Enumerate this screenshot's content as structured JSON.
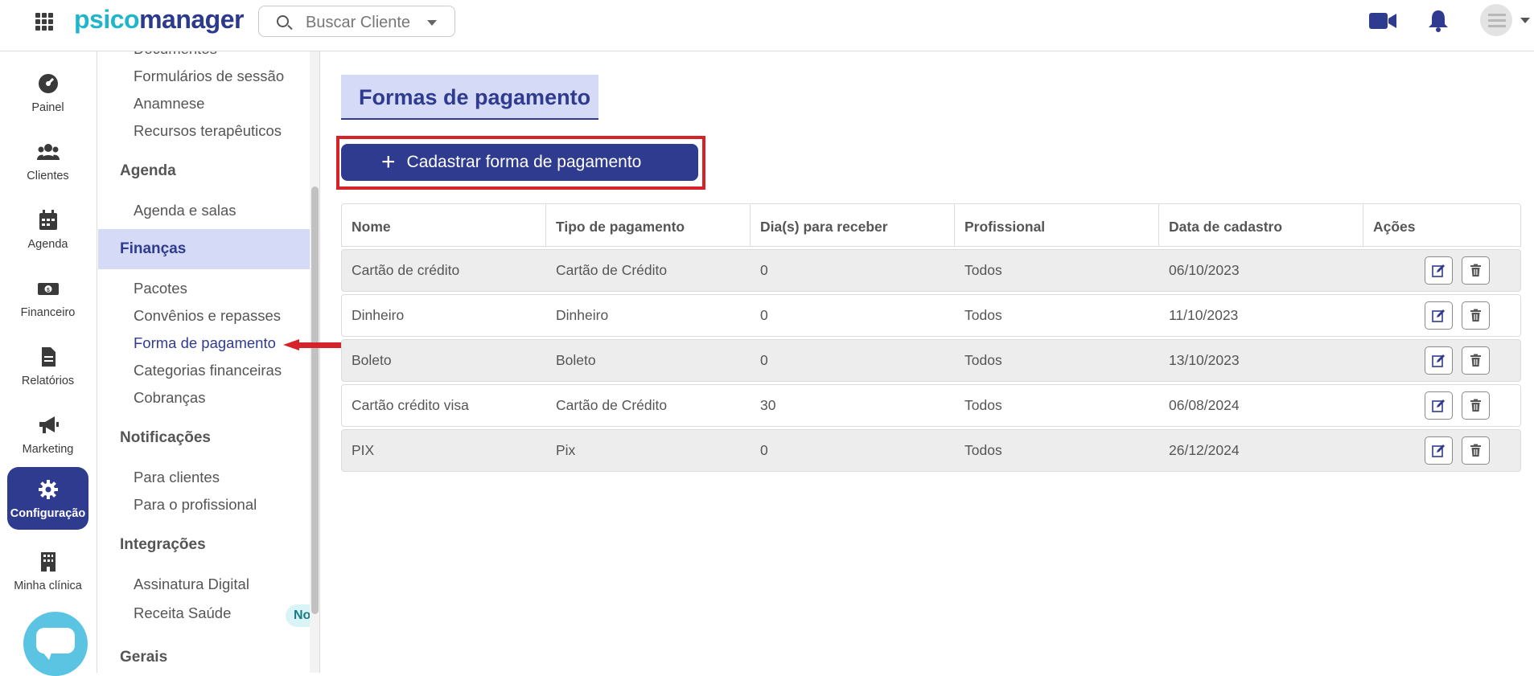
{
  "header": {
    "logo_part1": "psico",
    "logo_part2": "manager",
    "search_placeholder": "Buscar Cliente"
  },
  "rail": {
    "items": [
      {
        "label": "Painel",
        "icon": "dashboard-icon"
      },
      {
        "label": "Clientes",
        "icon": "users-icon"
      },
      {
        "label": "Agenda",
        "icon": "calendar-icon"
      },
      {
        "label": "Financeiro",
        "icon": "money-icon"
      },
      {
        "label": "Relatórios",
        "icon": "document-icon"
      },
      {
        "label": "Marketing",
        "icon": "megaphone-icon"
      },
      {
        "label": "Configuração",
        "icon": "gear-icon",
        "active": true
      },
      {
        "label": "Minha clínica",
        "icon": "building-icon"
      }
    ]
  },
  "submenu": {
    "cut_top": "Documentos",
    "links_top": [
      "Formulários de sessão",
      "Anamnese",
      "Recursos terapêuticos"
    ],
    "agenda_head": "Agenda",
    "agenda_links": [
      "Agenda e salas"
    ],
    "financas_head": "Finanças",
    "financas_links": [
      "Pacotes",
      "Convênios e repasses",
      "Forma de pagamento",
      "Categorias financeiras",
      "Cobranças"
    ],
    "notificacoes_head": "Notificações",
    "notificacoes_links": [
      "Para clientes",
      "Para o profissional"
    ],
    "integracoes_head": "Integrações",
    "integracoes_links": [
      "Assinatura Digital",
      "Receita Saúde"
    ],
    "novo_badge": "Novo",
    "gerais_head": "Gerais"
  },
  "main": {
    "title": "Formas de pagamento",
    "add_button": "Cadastrar forma de pagamento",
    "columns": [
      "Nome",
      "Tipo de pagamento",
      "Dia(s) para receber",
      "Profissional",
      "Data de cadastro",
      "Ações"
    ],
    "rows": [
      {
        "nome": "Cartão de crédito",
        "tipo": "Cartão de Crédito",
        "dias": "0",
        "profissional": "Todos",
        "data": "06/10/2023"
      },
      {
        "nome": "Dinheiro",
        "tipo": "Dinheiro",
        "dias": "0",
        "profissional": "Todos",
        "data": "11/10/2023"
      },
      {
        "nome": "Boleto",
        "tipo": "Boleto",
        "dias": "0",
        "profissional": "Todos",
        "data": "13/10/2023"
      },
      {
        "nome": "Cartão crédito visa",
        "tipo": "Cartão de Crédito",
        "dias": "30",
        "profissional": "Todos",
        "data": "06/08/2024"
      },
      {
        "nome": "PIX",
        "tipo": "Pix",
        "dias": "0",
        "profissional": "Todos",
        "data": "26/12/2024"
      }
    ]
  },
  "colors": {
    "primary": "#2f3b8f",
    "accent": "#1fb6c9",
    "highlight_bg": "#d5daf7",
    "annotation_red": "#d6232a"
  }
}
